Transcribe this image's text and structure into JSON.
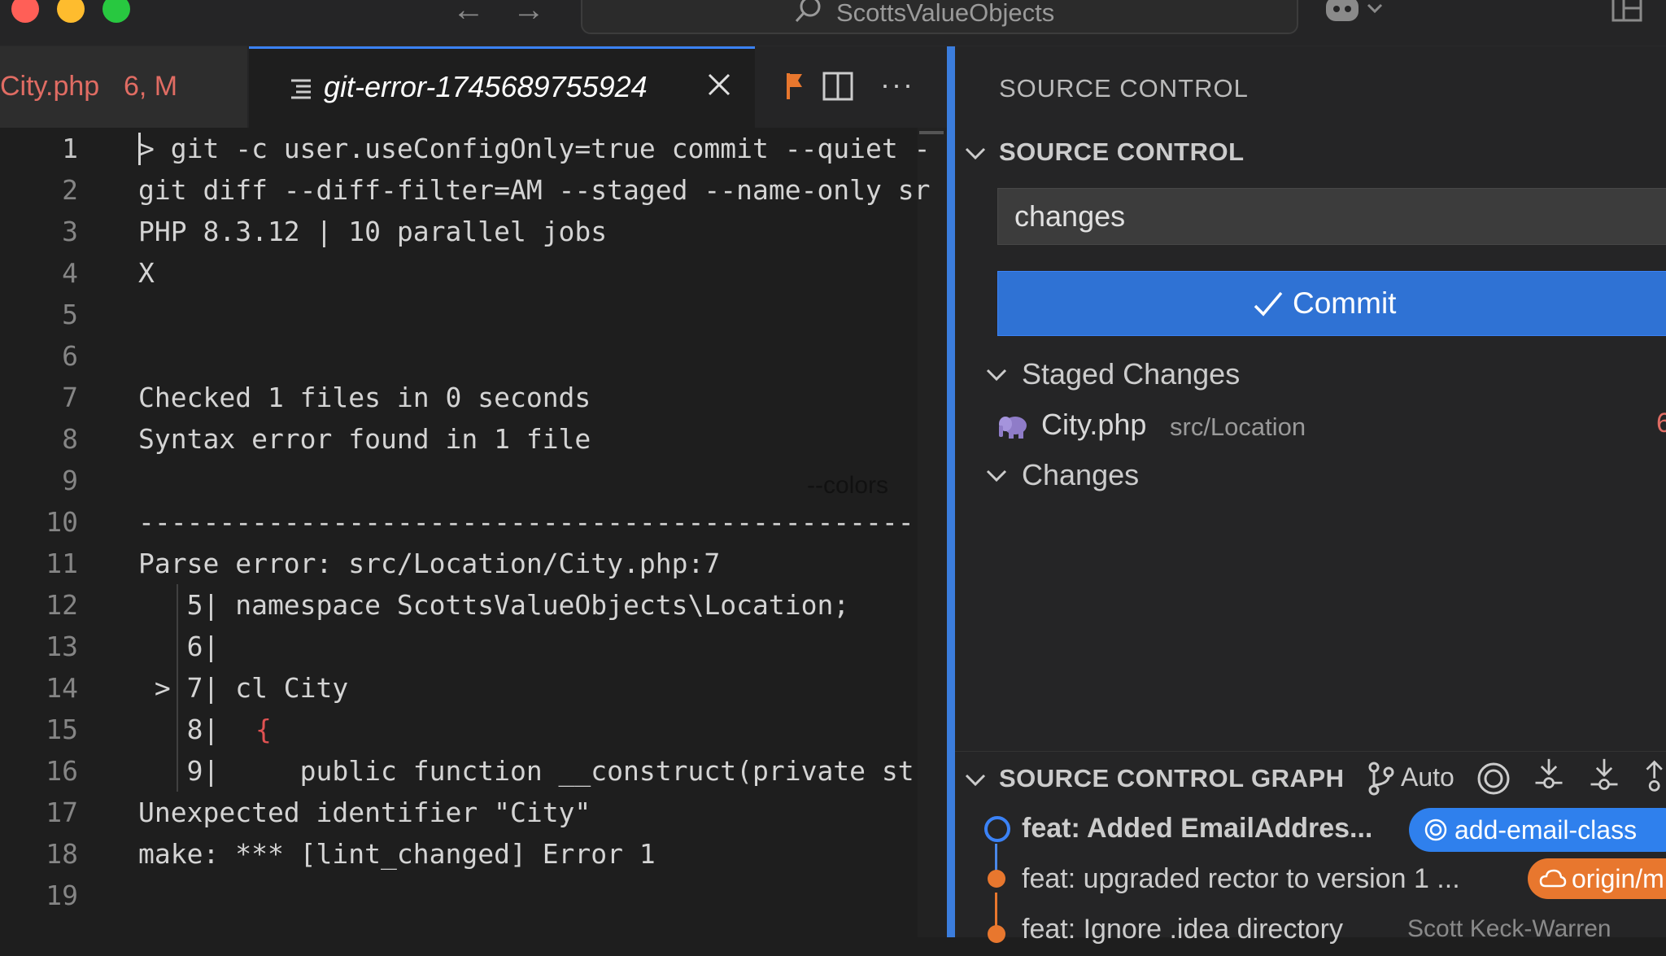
{
  "titlebar": {
    "command_center_text": "ScottsValueObjects"
  },
  "tabs": [
    {
      "label": "City.php",
      "badge": "6, M"
    },
    {
      "label": "git-error-1745689755924"
    }
  ],
  "editor": {
    "lines": [
      {
        "num": "1",
        "text": "> git -c user.useConfigOnly=true commit --quiet -"
      },
      {
        "num": "2",
        "text": "git diff --diff-filter=AM --staged --name-only sr"
      },
      {
        "num": "3",
        "text": "PHP 8.3.12 | 10 parallel jobs"
      },
      {
        "num": "4",
        "text": "X"
      },
      {
        "num": "5",
        "text": ""
      },
      {
        "num": "6",
        "text": ""
      },
      {
        "num": "7",
        "text": "Checked 1 files in 0 seconds"
      },
      {
        "num": "8",
        "text": "Syntax error found in 1 file"
      },
      {
        "num": "9",
        "text": ""
      },
      {
        "num": "10",
        "text": "------------------------------------------------"
      },
      {
        "num": "11",
        "text": "Parse error: src/Location/City.php:7"
      },
      {
        "num": "12",
        "text": "   5| namespace ScottsValueObjects\\Location;"
      },
      {
        "num": "13",
        "text": "   6|"
      },
      {
        "num": "14",
        "text": " > 7| cl City"
      },
      {
        "num": "15",
        "text": "   8| "
      },
      {
        "num": "16",
        "text": "   9|     public function __construct(private st"
      },
      {
        "num": "17",
        "text": "Unexpected identifier \"City\""
      },
      {
        "num": "18",
        "text": "make: *** [lint_changed] Error 1"
      },
      {
        "num": "19",
        "text": ""
      }
    ],
    "brace": "{",
    "colors_tooltip": "--colors"
  },
  "sidebar": {
    "title": "SOURCE CONTROL",
    "section_title": "SOURCE CONTROL",
    "commit_message_value": "changes",
    "commit_button_label": "Commit",
    "staged_changes_label": "Staged Changes",
    "staged_file": {
      "name": "City.php",
      "path": "src/Location",
      "badge": "6"
    },
    "changes_label": "Changes",
    "graph": {
      "title": "SOURCE CONTROL GRAPH",
      "auto_label": "Auto",
      "commits": [
        {
          "message": "feat: Added EmailAddres...",
          "badge": "add-email-class"
        },
        {
          "message": "feat: upgraded rector to version 1 ...",
          "badge": "origin/m"
        },
        {
          "message": "feat: Ignore .idea directory",
          "author": "Scott Keck-Warren"
        }
      ]
    }
  },
  "colors": {
    "accent": "#3b82f6",
    "commit_button": "#2f72d4",
    "modified": "#e06c63",
    "remote_branch": "#e8772e"
  }
}
